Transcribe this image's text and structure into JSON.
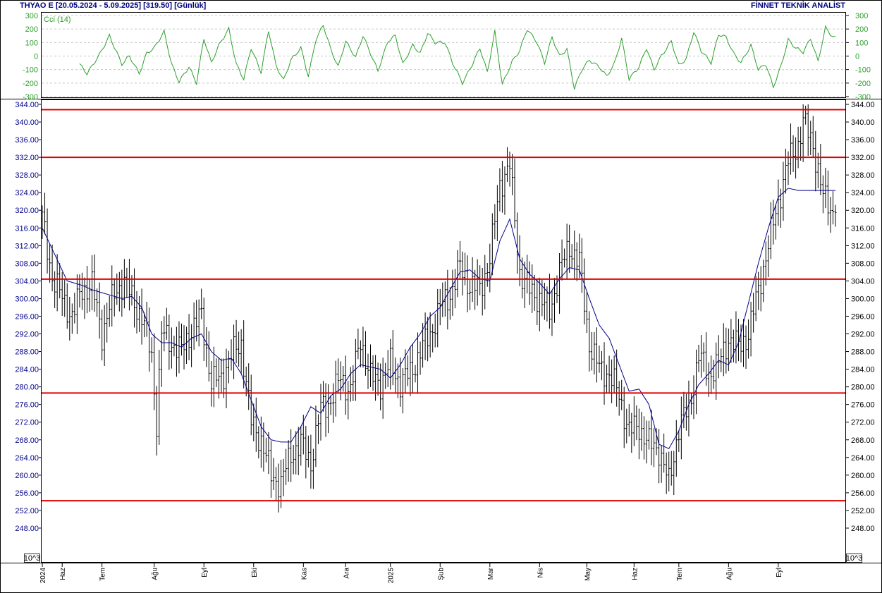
{
  "header": {
    "title": "THYAO E  [20.05.2024 - 5.09.2025]  [319.50]  [Günlük]",
    "brand": "FİNNET TEKNİK ANALİST"
  },
  "colors": {
    "frame": "#000000",
    "bars": "#000000",
    "moving_average": "#00008b",
    "support_resistance": "#e00000",
    "cci": "#2ca02c",
    "axis_text": "#00008b",
    "cci_axis_text": "#2ca02c"
  },
  "chart_data": [
    {
      "type": "line",
      "title": "Cci (14)",
      "y_ticks": [
        300,
        200,
        100,
        0,
        -100,
        -200,
        -300
      ],
      "y_tick_labels": [
        "300",
        "200",
        "100",
        "0",
        "-100",
        "-200",
        "-300"
      ],
      "ylim": [
        -300,
        300
      ],
      "grid": true,
      "x_index": [
        0,
        3,
        8,
        12,
        17,
        20,
        24,
        27,
        30,
        34,
        37,
        40,
        44,
        47,
        50,
        53,
        56,
        60,
        63,
        66,
        69,
        73,
        76,
        79,
        82,
        85,
        89,
        92,
        95,
        98,
        101,
        104,
        107,
        111,
        114,
        117,
        120,
        124,
        127,
        130,
        134,
        137,
        140,
        143,
        147,
        150,
        154,
        158,
        161,
        164,
        167,
        170,
        174,
        177,
        180,
        184,
        187,
        190,
        193,
        196,
        199,
        202,
        205,
        209,
        212,
        215,
        218,
        221,
        225,
        228,
        231,
        234,
        238,
        241,
        244,
        247,
        250,
        254,
        257,
        260,
        263,
        266,
        270,
        273,
        276,
        279,
        282,
        285,
        288,
        291,
        294,
        297,
        300,
        303,
        306,
        310,
        313,
        316,
        319
      ],
      "values": [
        -60,
        -130,
        10,
        150,
        -60,
        0,
        -130,
        20,
        60,
        180,
        -60,
        -190,
        -80,
        -200,
        130,
        -50,
        80,
        200,
        -60,
        -170,
        60,
        -120,
        190,
        -70,
        -180,
        -30,
        60,
        -150,
        120,
        230,
        50,
        -80,
        110,
        -10,
        150,
        20,
        -110,
        110,
        150,
        -60,
        80,
        20,
        170,
        100,
        100,
        -50,
        -200,
        -60,
        60,
        -120,
        180,
        -210,
        -40,
        40,
        200,
        100,
        -50,
        140,
        0,
        50,
        -240,
        -100,
        -30,
        -80,
        -150,
        -60,
        130,
        -170,
        -80,
        60,
        -100,
        0,
        110,
        -70,
        -20,
        180,
        40,
        -50,
        160,
        140,
        20,
        -50,
        80,
        -100,
        -60,
        -230,
        -80,
        120,
        60,
        30,
        130,
        -40,
        210,
        140,
        130,
        100,
        60,
        -120,
        -170
      ],
      "line_color": "#2ca02c"
    },
    {
      "type": "bar",
      "subtype": "ohlc",
      "series_label": "THYAO E",
      "ylim": [
        244,
        344
      ],
      "y_ticks": [
        344,
        340,
        336,
        332,
        328,
        324,
        320,
        316,
        312,
        308,
        304,
        300,
        296,
        292,
        288,
        284,
        280,
        276,
        272,
        268,
        264,
        260,
        256,
        252,
        248
      ],
      "y_tick_labels": [
        "344.00",
        "340.00",
        "336.00",
        "332.00",
        "328.00",
        "324.00",
        "320.00",
        "316.00",
        "312.00",
        "308.00",
        "304.00",
        "300.00",
        "296.00",
        "292.00",
        "288.00",
        "284.00",
        "280.00",
        "276.00",
        "272.00",
        "268.00",
        "264.00",
        "260.00",
        "256.00",
        "252.00",
        "248.00"
      ],
      "scale_label": "10^3",
      "x_labels": [
        "2024",
        "Haz",
        "Tem",
        "Ağu",
        "Eyl",
        "Eki",
        "Kas",
        "Ara",
        "2025",
        "Şub",
        "Mar",
        "Nis",
        "May",
        "Haz",
        "Tem",
        "Ağu",
        "Eyl"
      ],
      "x_label_index": [
        0,
        8,
        24,
        45,
        65,
        85,
        105,
        122,
        140,
        160,
        180,
        200,
        219,
        238,
        256,
        276,
        296
      ],
      "last_close": 319.5,
      "horizontal_levels": [
        342.8,
        332.0,
        304.4,
        278.6,
        254.2
      ],
      "price_anchors": {
        "index": [
          0,
          4,
          8,
          12,
          16,
          20,
          24,
          27,
          30,
          33,
          36,
          40,
          44,
          46,
          48,
          52,
          56,
          60,
          64,
          68,
          72,
          76,
          80,
          84,
          88,
          92,
          96,
          100,
          104,
          108,
          112,
          116,
          120,
          124,
          128,
          132,
          136,
          140,
          144,
          148,
          152,
          156,
          160,
          164,
          168,
          172,
          176,
          180,
          184,
          188,
          192,
          196,
          200,
          204,
          208,
          212,
          216,
          220,
          224,
          228,
          232,
          236,
          240,
          244,
          248,
          252,
          256,
          260,
          264,
          268,
          272,
          276,
          280,
          284,
          288,
          292,
          296,
          300,
          304,
          306,
          310,
          314,
          318,
          319
        ],
        "close": [
          318,
          305,
          300,
          296,
          302,
          303,
          292,
          298,
          302,
          304,
          300,
          296,
          287,
          272,
          292,
          290,
          288,
          293,
          296,
          281,
          282,
          287,
          290,
          272,
          268,
          260,
          258,
          265,
          267,
          263,
          275,
          277,
          282,
          279,
          291,
          282,
          281,
          285,
          281,
          283,
          288,
          292,
          298,
          301,
          307,
          303,
          302,
          309,
          326,
          330,
          306,
          302,
          300,
          297,
          306,
          312,
          308,
          290,
          284,
          283,
          278,
          270,
          271,
          267,
          266,
          258,
          271,
          275,
          287,
          283,
          285,
          291,
          289,
          292,
          302,
          312,
          322,
          331,
          335,
          340,
          335,
          323,
          320,
          319.5
        ]
      },
      "moving_average": {
        "index": [
          0,
          10,
          16,
          20,
          26,
          32,
          36,
          40,
          44,
          48,
          52,
          56,
          60,
          64,
          68,
          72,
          76,
          80,
          84,
          88,
          92,
          96,
          100,
          104,
          108,
          112,
          116,
          120,
          124,
          128,
          132,
          136,
          140,
          144,
          148,
          152,
          156,
          160,
          164,
          168,
          172,
          176,
          180,
          184,
          188,
          192,
          196,
          200,
          204,
          208,
          212,
          216,
          220,
          224,
          228,
          232,
          236,
          240,
          244,
          248,
          252,
          256,
          260,
          264,
          268,
          272,
          276,
          280,
          284,
          288,
          292,
          296,
          300,
          304,
          308,
          312,
          316,
          319
        ],
        "value": [
          316,
          304,
          303,
          302,
          301,
          300,
          300.5,
          298,
          292,
          290,
          290,
          289,
          291,
          292,
          288,
          286,
          286.5,
          283,
          277,
          271,
          268,
          267.5,
          267.5,
          271,
          275.5,
          274,
          278,
          279.5,
          283,
          285,
          284.5,
          284,
          282,
          285,
          289,
          292,
          296,
          298,
          302,
          306,
          306.5,
          304.5,
          304,
          313,
          318,
          309,
          305.5,
          303.5,
          301,
          304.5,
          307,
          306.5,
          300,
          294,
          291,
          285,
          279,
          279.5,
          276,
          267,
          266,
          270,
          276,
          280.5,
          283,
          286,
          285,
          290,
          299,
          308,
          316,
          323,
          325,
          324.5,
          324.5,
          324.5,
          324.5,
          324.5
        ]
      }
    }
  ]
}
